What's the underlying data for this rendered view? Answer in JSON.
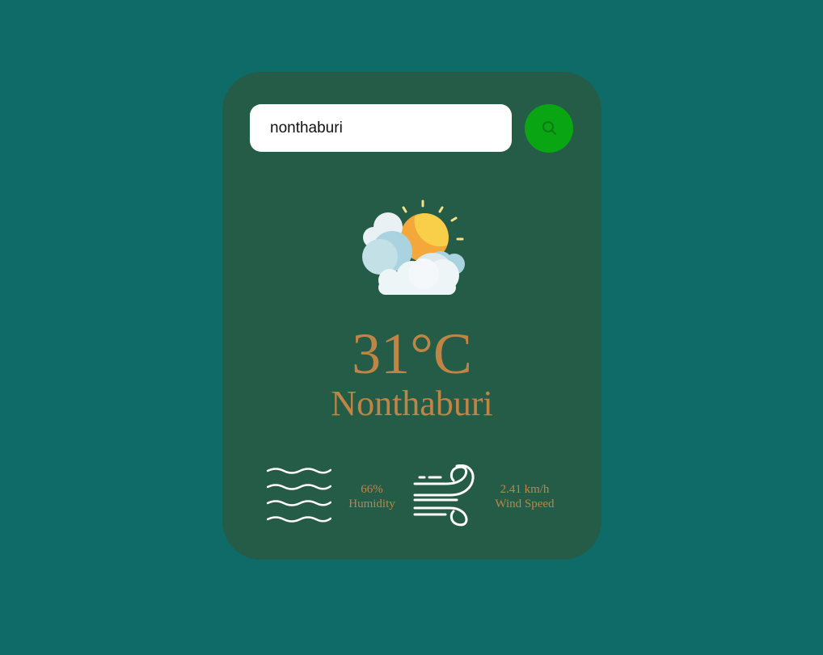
{
  "search": {
    "value": "nonthaburi",
    "button_icon": "search-icon"
  },
  "weather": {
    "icon": "sun-behind-clouds-icon",
    "temperature": "31°C",
    "city": "Nonthaburi"
  },
  "details": {
    "humidity": {
      "icon": "humidity-waves-icon",
      "value": "66%",
      "label": "Humidity"
    },
    "wind": {
      "icon": "wind-icon",
      "value": "2.41 km/h",
      "label": "Wind Speed"
    }
  },
  "colors": {
    "background": "#0f6b68",
    "card": "#245c48",
    "accent_text": "#c08444",
    "search_button": "#0aa513"
  }
}
